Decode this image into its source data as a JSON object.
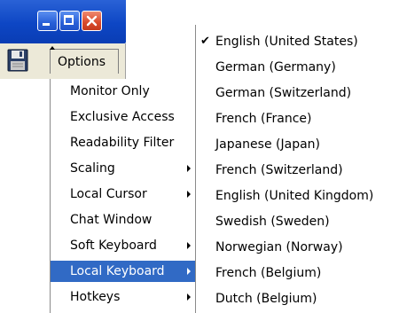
{
  "window": {
    "controls": [
      {
        "name": "minimize-button",
        "icon": "minimize-icon"
      },
      {
        "name": "maximize-button",
        "icon": "maximize-icon"
      },
      {
        "name": "close-button",
        "icon": "close-icon"
      }
    ]
  },
  "toolbar": {
    "save_icon": "floppy-disk-icon",
    "options_label": "Options"
  },
  "options_menu": {
    "items": [
      {
        "label": "Monitor Only",
        "submenu": false,
        "selected": false
      },
      {
        "label": "Exclusive Access",
        "submenu": false,
        "selected": false
      },
      {
        "label": "Readability Filter",
        "submenu": false,
        "selected": false
      },
      {
        "label": "Scaling",
        "submenu": true,
        "selected": false
      },
      {
        "label": "Local Cursor",
        "submenu": true,
        "selected": false
      },
      {
        "label": "Chat Window",
        "submenu": false,
        "selected": false
      },
      {
        "label": "Soft Keyboard",
        "submenu": true,
        "selected": false
      },
      {
        "label": "Local Keyboard",
        "submenu": true,
        "selected": true
      },
      {
        "label": "Hotkeys",
        "submenu": true,
        "selected": false
      }
    ]
  },
  "keyboard_submenu": {
    "items": [
      {
        "label": "English (United States)",
        "checked": true
      },
      {
        "label": "German (Germany)",
        "checked": false
      },
      {
        "label": "German (Switzerland)",
        "checked": false
      },
      {
        "label": "French (France)",
        "checked": false
      },
      {
        "label": "Japanese (Japan)",
        "checked": false
      },
      {
        "label": "French (Switzerland)",
        "checked": false
      },
      {
        "label": "English (United Kingdom)",
        "checked": false
      },
      {
        "label": "Swedish (Sweden)",
        "checked": false
      },
      {
        "label": "Norwegian (Norway)",
        "checked": false
      },
      {
        "label": "French (Belgium)",
        "checked": false
      },
      {
        "label": "Dutch (Belgium)",
        "checked": false
      }
    ]
  },
  "colors": {
    "selection_bg": "#316ac5",
    "titlebar": "#0d46c4",
    "close_button": "#d9492a"
  }
}
